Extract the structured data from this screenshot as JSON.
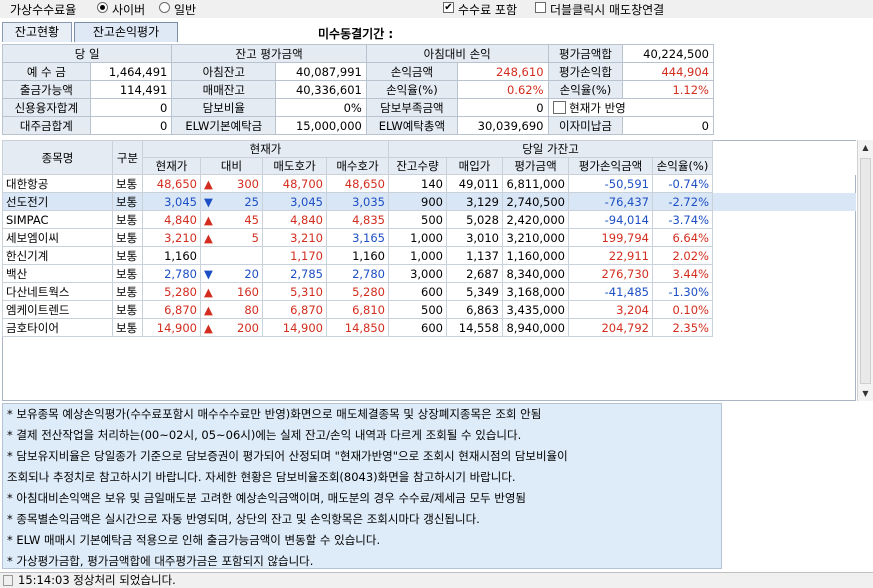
{
  "top": {
    "fee_rate_label": "가상수수료율",
    "radio_cyber": "사이버",
    "radio_general": "일반",
    "chk_fee_include": "수수료 포함",
    "chk_doubleclick": "더블클릭시 매도창연결"
  },
  "tabs": [
    "잔고현황",
    "잔고손익평가"
  ],
  "misu_label": "미수동결기간 :",
  "summary": {
    "dangil": "당 일",
    "yesugeum": "예 수 금",
    "yesugeum_v": "1,464,491",
    "chulgeum": "출금가능액",
    "chulgeum_v": "114,491",
    "sinyong": "신용융자합계",
    "sinyong_v": "0",
    "daeju": "대주금합계",
    "daeju_v": "0",
    "janko_eval": "잔고 평가금액",
    "morning": "아침잔고",
    "morning_v": "40,087,991",
    "trade": "매매잔고",
    "trade_v": "40,336,601",
    "dambo": "담보비율",
    "dambo_v": "0%",
    "elw_deposit": "ELW기본예탁금",
    "elw_deposit_v": "15,000,000",
    "morning_cmp": "아침대비 손익",
    "pl_amt": "손익금액",
    "pl_amt_v": "248,610",
    "pl_rate": "손익율(%)",
    "pl_rate_v": "0.62%",
    "dambo_short": "담보부족금액",
    "dambo_short_v": "0",
    "elw_total": "ELW예탁총액",
    "elw_total_v": "30,039,690",
    "eval_total": "평가금액합",
    "eval_total_v": "40,224,500",
    "eval_pl": "평가손익합",
    "eval_pl_v": "444,904",
    "pl_rate2": "손익율(%)",
    "pl_rate2_v": "1.12%",
    "chk_current": "현재가 반영",
    "interest": "이자미납금",
    "interest_v": "0"
  },
  "grid": {
    "header_top": {
      "name": "종목명",
      "gubun": "구분",
      "current": "현재가",
      "today": "당일 가잔고"
    },
    "header_sub": [
      "현재가",
      "대비",
      "매도호가",
      "매수호가",
      "잔고수량",
      "매입가",
      "평가금액",
      "평가손익금액",
      "손익율(%)"
    ],
    "rows": [
      {
        "name": "대한항공",
        "gubun": "보통",
        "price": "48,650",
        "dir": "up",
        "diff": "300",
        "ask": "48,700",
        "bid": "48,650",
        "qty": "140",
        "buy": "49,011",
        "eval": "6,811,000",
        "pl": "-50,591",
        "rate": "-0.74%",
        "pc": "red",
        "askc": "red",
        "bidc": "red",
        "plc": "blue"
      },
      {
        "name": "선도전기",
        "gubun": "보통",
        "price": "3,045",
        "dir": "down",
        "diff": "25",
        "ask": "3,045",
        "bid": "3,035",
        "qty": "900",
        "buy": "3,129",
        "eval": "2,740,500",
        "pl": "-76,437",
        "rate": "-2.72%",
        "pc": "blue",
        "askc": "blue",
        "bidc": "blue",
        "plc": "blue"
      },
      {
        "name": "SIMPAC",
        "gubun": "보통",
        "price": "4,840",
        "dir": "up",
        "diff": "45",
        "ask": "4,840",
        "bid": "4,835",
        "qty": "500",
        "buy": "5,028",
        "eval": "2,420,000",
        "pl": "-94,014",
        "rate": "-3.74%",
        "pc": "red",
        "askc": "red",
        "bidc": "red",
        "plc": "blue"
      },
      {
        "name": "세보엠이씨",
        "gubun": "보통",
        "price": "3,210",
        "dir": "up",
        "diff": "5",
        "ask": "3,210",
        "bid": "3,165",
        "qty": "1,000",
        "buy": "3,010",
        "eval": "3,210,000",
        "pl": "199,794",
        "rate": "6.64%",
        "pc": "red",
        "askc": "red",
        "bidc": "blue",
        "plc": "red"
      },
      {
        "name": "한신기계",
        "gubun": "보통",
        "price": "1,160",
        "dir": "none",
        "diff": "",
        "ask": "1,170",
        "bid": "1,160",
        "qty": "1,000",
        "buy": "1,137",
        "eval": "1,160,000",
        "pl": "22,911",
        "rate": "2.02%",
        "pc": "",
        "askc": "red",
        "bidc": "",
        "plc": "red"
      },
      {
        "name": "백산",
        "gubun": "보통",
        "price": "2,780",
        "dir": "down",
        "diff": "20",
        "ask": "2,785",
        "bid": "2,780",
        "qty": "3,000",
        "buy": "2,687",
        "eval": "8,340,000",
        "pl": "276,730",
        "rate": "3.44%",
        "pc": "blue",
        "askc": "blue",
        "bidc": "blue",
        "plc": "red"
      },
      {
        "name": "다산네트웍스",
        "gubun": "보통",
        "price": "5,280",
        "dir": "up",
        "diff": "160",
        "ask": "5,310",
        "bid": "5,280",
        "qty": "600",
        "buy": "5,349",
        "eval": "3,168,000",
        "pl": "-41,485",
        "rate": "-1.30%",
        "pc": "red",
        "askc": "red",
        "bidc": "red",
        "plc": "blue"
      },
      {
        "name": "엠케이트렌드",
        "gubun": "보통",
        "price": "6,870",
        "dir": "up",
        "diff": "80",
        "ask": "6,870",
        "bid": "6,810",
        "qty": "500",
        "buy": "6,863",
        "eval": "3,435,000",
        "pl": "3,204",
        "rate": "0.10%",
        "pc": "red",
        "askc": "red",
        "bidc": "red",
        "plc": "red"
      },
      {
        "name": "금호타이어",
        "gubun": "보통",
        "price": "14,900",
        "dir": "up",
        "diff": "200",
        "ask": "14,900",
        "bid": "14,850",
        "qty": "600",
        "buy": "14,558",
        "eval": "8,940,000",
        "pl": "204,792",
        "rate": "2.35%",
        "pc": "red",
        "askc": "red",
        "bidc": "red",
        "plc": "red"
      }
    ]
  },
  "notes": [
    "* 보유종목 예상손익평가(수수료포함시 매수수수료만 반영)화면으로 매도체결종목 및 상장폐지종목은 조회 안됨",
    "* 결제 전산작업을 처리하는(00~02시, 05~06시)에는 실제 잔고/손익 내역과 다르게 조회될 수 있습니다.",
    "* 담보유지비율은 당일종가 기준으로 담보증권이 평가되어 산정되며 \"현재가반영\"으로 조회시 현재시점의 담보비율이",
    "  조회되나 추정치로 참고하시기 바랍니다. 자세한 현황은 담보비율조회(8043)화면을 참고하시기 바랍니다.",
    "* 아침대비손익액은 보유 및 금일매도분 고려한 예상손익금액이며, 매도분의 경우 수수료/제세금 모두 반영됨",
    "* 종목별손익금액은 실시간으로 자동 반영되며, 상단의 잔고 및 손익항목은 조회시마다 갱신됩니다.",
    "* ELW 매매시 기본예탁금 적용으로 인해 출금가능금액이 변동할 수 있습니다.",
    "* 가상평가금합, 평가금액합에 대주평가금은 포함되지 않습니다."
  ],
  "status_text": "15:14:03 정상처리 되었습니다.",
  "icons": {
    "up": "▲",
    "down": "▼",
    "check": "✔",
    "scroll_up": "▲",
    "scroll_down": "▼"
  }
}
